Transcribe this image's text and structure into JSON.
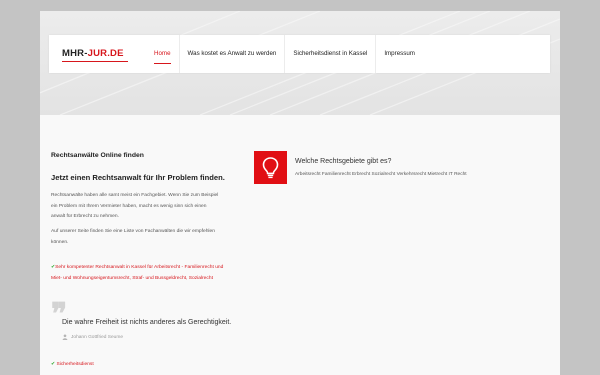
{
  "logo": {
    "part1": "MHR-",
    "part2": "JUR.DE"
  },
  "nav": [
    {
      "label": "Home",
      "active": true
    },
    {
      "label": "Was kostet es Anwalt zu werden",
      "active": false
    },
    {
      "label": "Sicherheitsdienst in Kassel",
      "active": false
    },
    {
      "label": "Impressum",
      "active": false
    }
  ],
  "left": {
    "subheading": "Rechtsanwälte Online finden",
    "heading": "Jetzt einen Rechtsanwalt für Ihr Problem finden.",
    "paragraph1": "Rechtsanwälte haben alle samt meist ein Fachgebiet. Wenn Sie zum Beispiel ein Problem mit Ihrem Vermieter haben, macht es wenig sinn sich einen anwalt für Erbrecht zu nehmen.",
    "paragraph2": "Auf unserer Seite finden Sie eine Liste von Fachanwälten die wir empfehlen können.",
    "check_link": "Sehr kompetenter Rechtsanwalt in Kassel für Arbeitsrecht - Familienrecht und Miet- und Wohnungseigentumsrecht, Straf- und Bussgeldrecht, Sozialrecht"
  },
  "quote": {
    "text": "Die wahre Freiheit ist nichts anderes als Gerechtigkeit.",
    "author": "Johann Gottfried Seume"
  },
  "security_link": "Sicherheitsdienst",
  "right": {
    "title": "Welche Rechtsgebiete gibt es?",
    "text": "Arbeitsrecht Familienrecht Erbrecht Sozialrecht Verkehrsrecht Mietrecht IT Recht"
  },
  "colors": {
    "accent": "#d7161c",
    "check": "#2ea82e",
    "icon_bg": "#e10f14"
  },
  "icons": {
    "bulb": "lightbulb-icon",
    "user": "user-icon",
    "check": "checkmark-icon",
    "quote": "quote-icon"
  }
}
